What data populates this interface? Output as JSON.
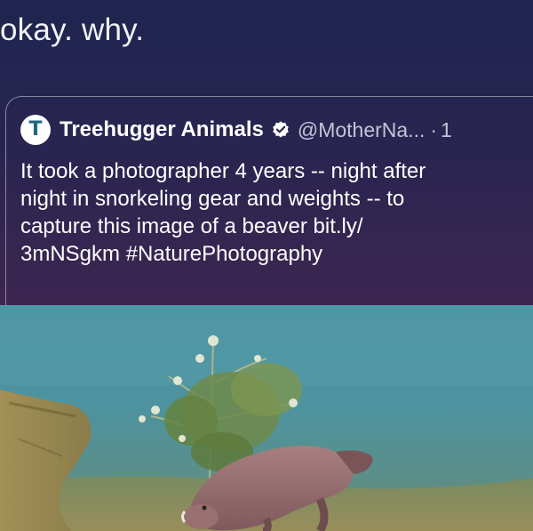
{
  "post": {
    "caption": "okay. why."
  },
  "quoted_tweet": {
    "avatar_letter": "T",
    "display_name": "Treehugger Animals",
    "handle": "@MotherNa...",
    "separator": "·",
    "time": "1",
    "text_lines": [
      "It took a photographer 4 years -- night after",
      "night in snorkeling gear and weights -- to",
      "capture this image of a beaver bit.ly/",
      "3mNSgkm #NaturePhotography"
    ]
  },
  "icons": {
    "verified": "verified-badge-icon",
    "avatar": "treehugger-logo-icon"
  },
  "colors": {
    "background_top": "#1f2550",
    "background_bottom": "#4a2852",
    "avatar_accent": "#1d6a82",
    "secondary_text": "#c7c3d6"
  }
}
